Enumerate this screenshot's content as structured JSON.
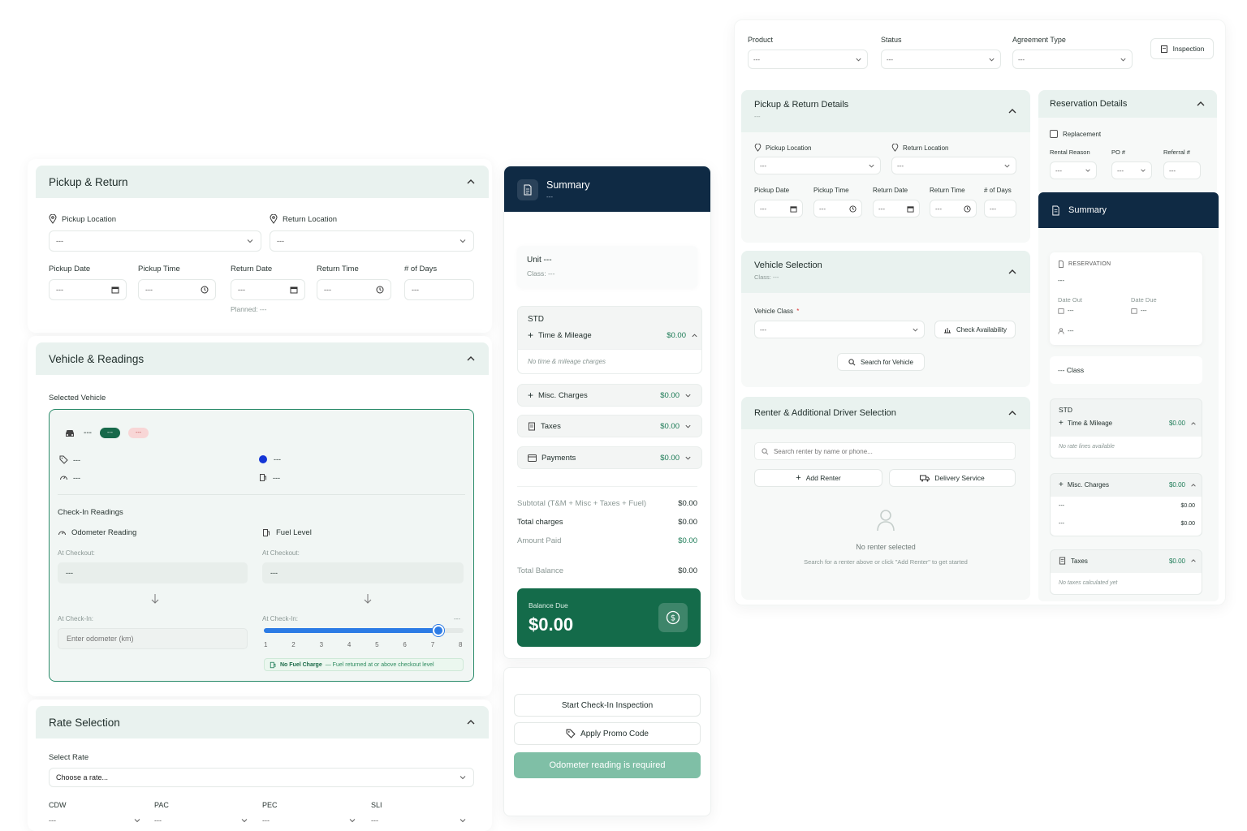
{
  "left": {
    "pickup_return": {
      "title": "Pickup & Return",
      "pickup_location_label": "Pickup Location",
      "return_location_label": "Return Location",
      "pickup_location_value": "---",
      "return_location_value": "---",
      "pickup_date_label": "Pickup Date",
      "pickup_time_label": "Pickup Time",
      "return_date_label": "Return Date",
      "return_time_label": "Return Time",
      "days_label": "# of Days",
      "pickup_date_value": "---",
      "pickup_time_value": "---",
      "return_date_value": "---",
      "return_time_value": "---",
      "days_value": "---",
      "planned": "Planned: ---"
    },
    "vehicle_readings": {
      "title": "Vehicle & Readings",
      "selected_vehicle_label": "Selected Vehicle",
      "vehicle_name": "---",
      "badge_green": "---",
      "badge_red": "---",
      "tag_value": "---",
      "color_value": "---",
      "odometer_value": "---",
      "fuel_value": "---",
      "checkin_readings_label": "Check-In Readings",
      "odometer_label": "Odometer Reading",
      "fuel_label": "Fuel Level",
      "at_checkout_label": "At Checkout:",
      "at_checkout_label2": "At Checkout:",
      "checkout_odo_value": "---",
      "checkout_fuel_value": "---",
      "at_checkin_label": "At Check-In:",
      "at_checkin_label2": "At Check-In:",
      "checkin_fuel_value": "---",
      "odometer_placeholder": "Enter odometer (km)",
      "fuel_level": 0.875,
      "fuel_ticks": [
        "1",
        "2",
        "3",
        "4",
        "5",
        "6",
        "7",
        "8"
      ],
      "no_fuel_title": "No Fuel Charge",
      "no_fuel_text": " — Fuel returned at or above checkout level"
    },
    "rate_selection": {
      "title": "Rate Selection",
      "select_rate_label": "Select Rate",
      "select_rate_placeholder": "Choose a rate...",
      "cols": [
        {
          "label": "CDW",
          "value": "---"
        },
        {
          "label": "PAC",
          "value": "---"
        },
        {
          "label": "PEC",
          "value": "---"
        },
        {
          "label": "SLI",
          "value": "---"
        }
      ]
    }
  },
  "summary": {
    "title": "Summary",
    "subtitle": "---",
    "unit": "Unit ---",
    "class": "Class: ---",
    "std": "STD",
    "time_mileage": "Time & Mileage",
    "time_mileage_amt": "$0.00",
    "no_tm": "No time & mileage charges",
    "misc": "Misc. Charges",
    "misc_amt": "$0.00",
    "taxes": "Taxes",
    "taxes_amt": "$0.00",
    "payments": "Payments",
    "payments_amt": "$0.00",
    "subtotal_label": "Subtotal (T&M + Misc + Taxes + Fuel)",
    "subtotal": "$0.00",
    "total_charges_label": "Total charges",
    "total_charges": "$0.00",
    "amount_paid_label": "Amount Paid",
    "amount_paid": "$0.00",
    "total_balance_label": "Total Balance",
    "total_balance": "$0.00",
    "balance_due_label": "Balance Due",
    "balance_due": "$0.00",
    "start_checkin": "Start Check-In Inspection",
    "apply_promo": "Apply Promo Code",
    "odometer_required": "Odometer reading is required"
  },
  "right": {
    "product_label": "Product",
    "status_label": "Status",
    "agreement_label": "Agreement Type",
    "product_value": "---",
    "status_value": "---",
    "agreement_value": "---",
    "inspection": "Inspection",
    "prd": {
      "title": "Pickup & Return Details",
      "sub": "---",
      "pickup_location": "Pickup Location",
      "return_location": "Return Location",
      "pickup_location_value": "---",
      "return_location_value": "---",
      "pickup_date": "Pickup Date",
      "pickup_time": "Pickup Time",
      "return_date": "Return Date",
      "return_time": "Return Time",
      "days": "# of Days",
      "v1": "---",
      "v2": "---",
      "v3": "---",
      "v4": "---",
      "v5": "---"
    },
    "vs": {
      "title": "Vehicle Selection",
      "sub": "Class: ---",
      "vehicle_class": "Vehicle Class",
      "required": "*",
      "vehicle_class_value": "---",
      "check_availability": "Check Availability",
      "search_vehicle": "Search for Vehicle"
    },
    "rd": {
      "title": "Renter & Additional Driver Selection",
      "search_placeholder": "Search renter by name or phone...",
      "add_renter": "Add Renter",
      "delivery_service": "Delivery Service",
      "no_renter": "No renter selected",
      "no_renter_hint": "Search for a renter above or click \"Add Renter\" to get started"
    },
    "res": {
      "title": "Reservation Details",
      "replacement": "Replacement",
      "rental_reason": "Rental Reason",
      "po": "PO #",
      "referral": "Referral #",
      "v1": "---",
      "v2": "---",
      "v3": "---"
    },
    "summary": {
      "title": "Summary",
      "reservation": "RESERVATION",
      "res_value": "---",
      "date_out": "Date Out",
      "date_due": "Date Due",
      "date_out_value": "---",
      "date_due_value": "---",
      "user_value": "---",
      "class": "--- Class",
      "std": "STD",
      "time_mileage": "Time & Mileage",
      "time_mileage_amt": "$0.00",
      "no_rate": "No rate lines available",
      "misc": "Misc. Charges",
      "misc_amt": "$0.00",
      "misc1_label": "---",
      "misc1_amt": "$0.00",
      "misc2_label": "---",
      "misc2_amt": "$0.00",
      "taxes": "Taxes",
      "taxes_amt": "$0.00",
      "no_taxes": "No taxes calculated yet"
    }
  }
}
